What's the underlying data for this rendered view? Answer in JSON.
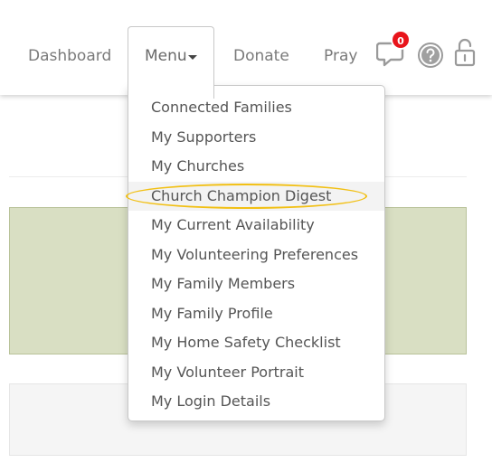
{
  "nav": {
    "dashboard": "Dashboard",
    "menu": "Menu",
    "donate": "Donate",
    "pray": "Pray",
    "notification_count": "0"
  },
  "dropdown": {
    "items": [
      "Connected Families",
      "My Supporters",
      "My Churches",
      "Church Champion Digest",
      "My Current Availability",
      "My Volunteering Preferences",
      "My Family Members",
      "My Family Profile",
      "My Home Safety Checklist",
      "My Volunteer Portrait",
      "My Login Details"
    ],
    "highlighted_item": "Church Champion Digest"
  },
  "colors": {
    "badge": "#e8141b",
    "highlight": "#f2c014",
    "panel_green": "#d9dfc3"
  },
  "icons": [
    "chat-bubble-icon",
    "help-icon",
    "unlock-icon"
  ]
}
